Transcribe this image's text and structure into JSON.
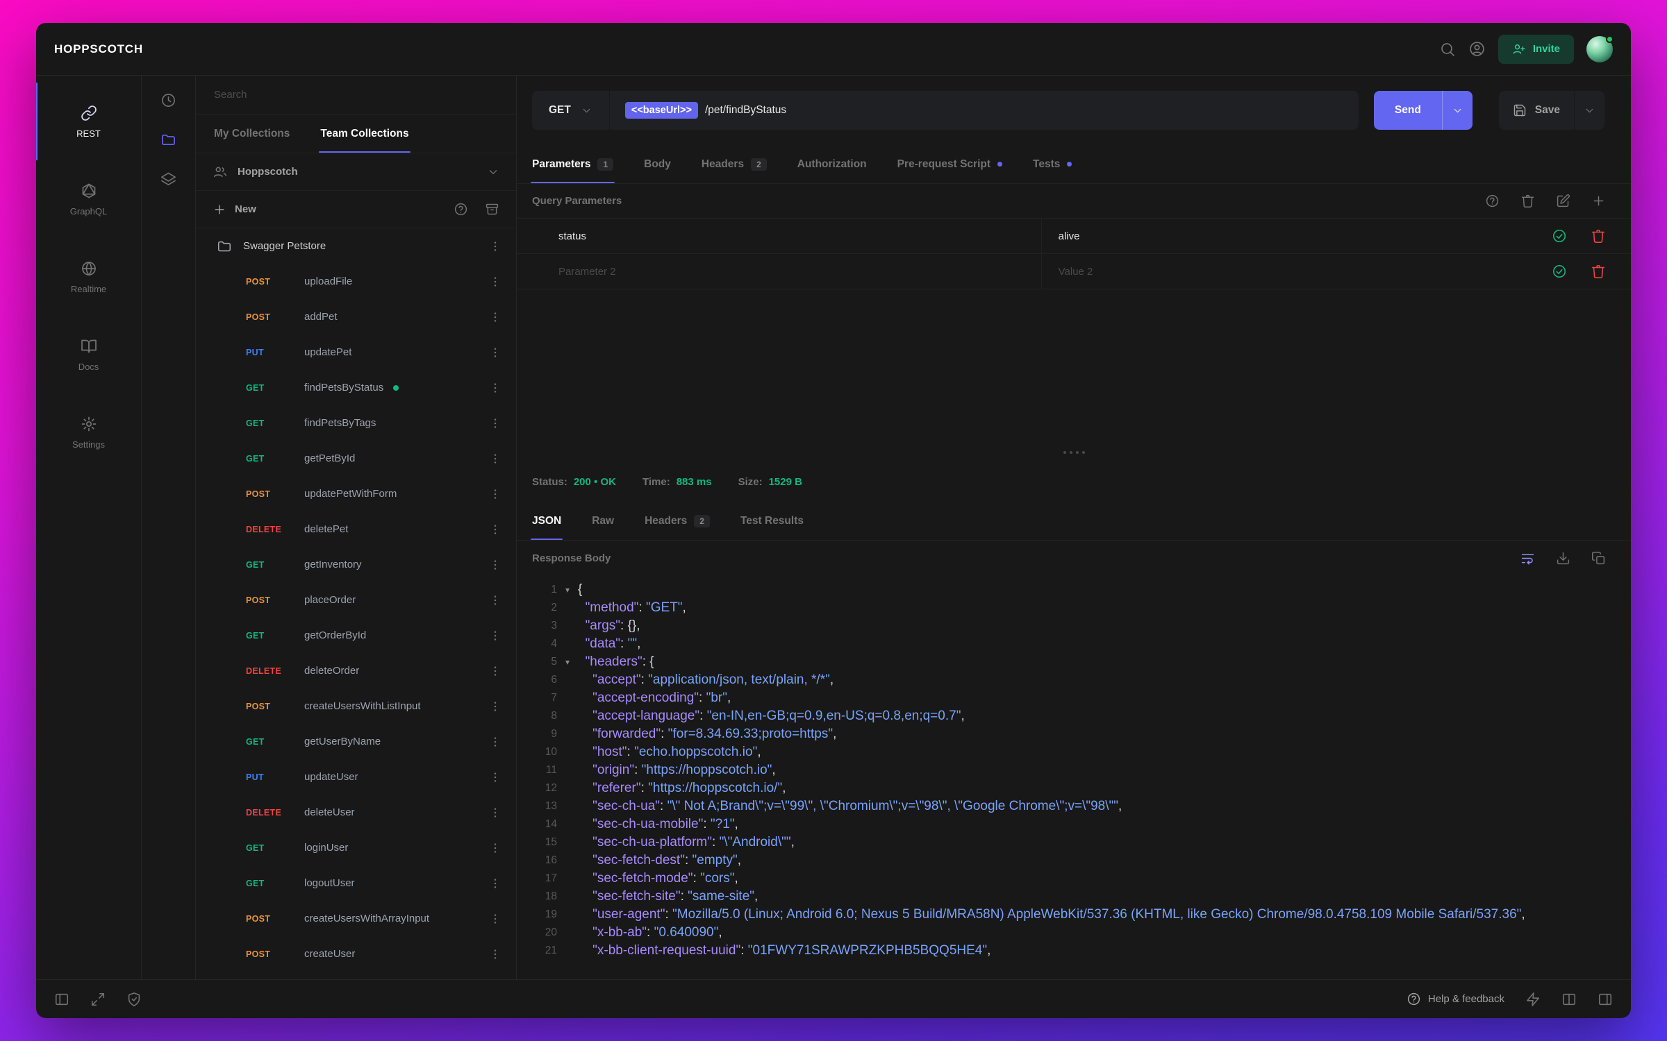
{
  "window": {
    "logo": "HOPPSCOTCH"
  },
  "topbar": {
    "invite_label": "Invite"
  },
  "icons": {
    "topbar": [
      "search-icon",
      "account-icon",
      "invite-person-plus-icon",
      "avatar"
    ],
    "nav": [
      "link-icon",
      "graphql-icon",
      "globe-icon",
      "book-icon",
      "settings-icon"
    ],
    "strip": [
      "history-clock-icon",
      "folder-icon",
      "layers-icon"
    ],
    "actions": [
      "help-circle-icon",
      "trash-icon",
      "edit-icon",
      "plus-icon",
      "check-circle-icon",
      "wrap-text-icon",
      "download-icon",
      "copy-icon"
    ],
    "bottombar": [
      "panel-left-icon",
      "expand-icon",
      "shield-check-icon",
      "zap-icon",
      "columns-icon",
      "panel-right-icon"
    ]
  },
  "nav": {
    "items": [
      {
        "label": "REST",
        "active": true
      },
      {
        "label": "GraphQL"
      },
      {
        "label": "Realtime"
      },
      {
        "label": "Docs"
      },
      {
        "label": "Settings"
      }
    ]
  },
  "collections": {
    "search_placeholder": "Search",
    "tabs": [
      {
        "label": "My Collections"
      },
      {
        "label": "Team Collections",
        "active": true
      }
    ],
    "team_name": "Hoppscotch",
    "new_label": "New",
    "folder_name": "Swagger Petstore",
    "requests": [
      {
        "method": "POST",
        "name": "uploadFile"
      },
      {
        "method": "POST",
        "name": "addPet"
      },
      {
        "method": "PUT",
        "name": "updatePet"
      },
      {
        "method": "GET",
        "name": "findPetsByStatus",
        "dot": true
      },
      {
        "method": "GET",
        "name": "findPetsByTags"
      },
      {
        "method": "GET",
        "name": "getPetById"
      },
      {
        "method": "POST",
        "name": "updatePetWithForm"
      },
      {
        "method": "DELETE",
        "name": "deletePet"
      },
      {
        "method": "GET",
        "name": "getInventory"
      },
      {
        "method": "POST",
        "name": "placeOrder"
      },
      {
        "method": "GET",
        "name": "getOrderById"
      },
      {
        "method": "DELETE",
        "name": "deleteOrder"
      },
      {
        "method": "POST",
        "name": "createUsersWithListInput"
      },
      {
        "method": "GET",
        "name": "getUserByName"
      },
      {
        "method": "PUT",
        "name": "updateUser"
      },
      {
        "method": "DELETE",
        "name": "deleteUser"
      },
      {
        "method": "GET",
        "name": "loginUser"
      },
      {
        "method": "GET",
        "name": "logoutUser"
      },
      {
        "method": "POST",
        "name": "createUsersWithArrayInput"
      },
      {
        "method": "POST",
        "name": "createUser"
      }
    ]
  },
  "request": {
    "method": "GET",
    "url_chip": "<<baseUrl>>",
    "url_path": "/pet/findByStatus",
    "send_label": "Send",
    "save_label": "Save",
    "tabs": [
      {
        "label": "Parameters",
        "badge": "1",
        "active": true
      },
      {
        "label": "Body"
      },
      {
        "label": "Headers",
        "badge": "2"
      },
      {
        "label": "Authorization"
      },
      {
        "label": "Pre-request Script",
        "dot": true
      },
      {
        "label": "Tests",
        "dot": true
      }
    ],
    "section_title": "Query Parameters",
    "params": [
      {
        "key": "status",
        "value": "alive",
        "filled": true
      },
      {
        "key": "Parameter 2",
        "value": "Value 2"
      }
    ]
  },
  "response": {
    "meta": {
      "status_label": "Status:",
      "status_value": "200 • OK",
      "time_label": "Time:",
      "time_value": "883 ms",
      "size_label": "Size:",
      "size_value": "1529 B"
    },
    "tabs": [
      {
        "label": "JSON",
        "active": true
      },
      {
        "label": "Raw"
      },
      {
        "label": "Headers",
        "badge": "2"
      },
      {
        "label": "Test Results"
      }
    ],
    "body_title": "Response Body",
    "code": [
      {
        "n": "1",
        "fold": true,
        "tokens": [
          [
            "p",
            "{"
          ]
        ]
      },
      {
        "n": "2",
        "tokens": [
          [
            "p",
            "  "
          ],
          [
            "k",
            "\"method\""
          ],
          [
            "p",
            ": "
          ],
          [
            "s",
            "\"GET\""
          ],
          [
            "p",
            ","
          ]
        ]
      },
      {
        "n": "3",
        "tokens": [
          [
            "p",
            "  "
          ],
          [
            "k",
            "\"args\""
          ],
          [
            "p",
            ": {},"
          ]
        ]
      },
      {
        "n": "4",
        "tokens": [
          [
            "p",
            "  "
          ],
          [
            "k",
            "\"data\""
          ],
          [
            "p",
            ": "
          ],
          [
            "s",
            "\"\""
          ],
          [
            "p",
            ","
          ]
        ]
      },
      {
        "n": "5",
        "fold": true,
        "tokens": [
          [
            "p",
            "  "
          ],
          [
            "k",
            "\"headers\""
          ],
          [
            "p",
            ": {"
          ]
        ]
      },
      {
        "n": "6",
        "tokens": [
          [
            "p",
            "    "
          ],
          [
            "k",
            "\"accept\""
          ],
          [
            "p",
            ": "
          ],
          [
            "s",
            "\"application/json, text/plain, */*\""
          ],
          [
            "p",
            ","
          ]
        ]
      },
      {
        "n": "7",
        "tokens": [
          [
            "p",
            "    "
          ],
          [
            "k",
            "\"accept-encoding\""
          ],
          [
            "p",
            ": "
          ],
          [
            "s",
            "\"br\""
          ],
          [
            "p",
            ","
          ]
        ]
      },
      {
        "n": "8",
        "tokens": [
          [
            "p",
            "    "
          ],
          [
            "k",
            "\"accept-language\""
          ],
          [
            "p",
            ": "
          ],
          [
            "s",
            "\"en-IN,en-GB;q=0.9,en-US;q=0.8,en;q=0.7\""
          ],
          [
            "p",
            ","
          ]
        ]
      },
      {
        "n": "9",
        "tokens": [
          [
            "p",
            "    "
          ],
          [
            "k",
            "\"forwarded\""
          ],
          [
            "p",
            ": "
          ],
          [
            "s",
            "\"for=8.34.69.33;proto=https\""
          ],
          [
            "p",
            ","
          ]
        ]
      },
      {
        "n": "10",
        "tokens": [
          [
            "p",
            "    "
          ],
          [
            "k",
            "\"host\""
          ],
          [
            "p",
            ": "
          ],
          [
            "s",
            "\"echo.hoppscotch.io\""
          ],
          [
            "p",
            ","
          ]
        ]
      },
      {
        "n": "11",
        "tokens": [
          [
            "p",
            "    "
          ],
          [
            "k",
            "\"origin\""
          ],
          [
            "p",
            ": "
          ],
          [
            "s",
            "\"https://hoppscotch.io\""
          ],
          [
            "p",
            ","
          ]
        ]
      },
      {
        "n": "12",
        "tokens": [
          [
            "p",
            "    "
          ],
          [
            "k",
            "\"referer\""
          ],
          [
            "p",
            ": "
          ],
          [
            "s",
            "\"https://hoppscotch.io/\""
          ],
          [
            "p",
            ","
          ]
        ]
      },
      {
        "n": "13",
        "tokens": [
          [
            "p",
            "    "
          ],
          [
            "k",
            "\"sec-ch-ua\""
          ],
          [
            "p",
            ": "
          ],
          [
            "s",
            "\"\\\" Not A;Brand\\\";v=\\\"99\\\", \\\"Chromium\\\";v=\\\"98\\\", \\\"Google Chrome\\\";v=\\\"98\\\"\""
          ],
          [
            "p",
            ","
          ]
        ]
      },
      {
        "n": "14",
        "tokens": [
          [
            "p",
            "    "
          ],
          [
            "k",
            "\"sec-ch-ua-mobile\""
          ],
          [
            "p",
            ": "
          ],
          [
            "s",
            "\"?1\""
          ],
          [
            "p",
            ","
          ]
        ]
      },
      {
        "n": "15",
        "tokens": [
          [
            "p",
            "    "
          ],
          [
            "k",
            "\"sec-ch-ua-platform\""
          ],
          [
            "p",
            ": "
          ],
          [
            "s",
            "\"\\\"Android\\\"\""
          ],
          [
            "p",
            ","
          ]
        ]
      },
      {
        "n": "16",
        "tokens": [
          [
            "p",
            "    "
          ],
          [
            "k",
            "\"sec-fetch-dest\""
          ],
          [
            "p",
            ": "
          ],
          [
            "s",
            "\"empty\""
          ],
          [
            "p",
            ","
          ]
        ]
      },
      {
        "n": "17",
        "tokens": [
          [
            "p",
            "    "
          ],
          [
            "k",
            "\"sec-fetch-mode\""
          ],
          [
            "p",
            ": "
          ],
          [
            "s",
            "\"cors\""
          ],
          [
            "p",
            ","
          ]
        ]
      },
      {
        "n": "18",
        "tokens": [
          [
            "p",
            "    "
          ],
          [
            "k",
            "\"sec-fetch-site\""
          ],
          [
            "p",
            ": "
          ],
          [
            "s",
            "\"same-site\""
          ],
          [
            "p",
            ","
          ]
        ]
      },
      {
        "n": "19",
        "tokens": [
          [
            "p",
            "    "
          ],
          [
            "k",
            "\"user-agent\""
          ],
          [
            "p",
            ": "
          ],
          [
            "s",
            "\"Mozilla/5.0 (Linux; Android 6.0; Nexus 5 Build/MRA58N) AppleWebKit/537.36 (KHTML, like Gecko) Chrome/98.0.4758.109 Mobile Safari/537.36\""
          ],
          [
            "p",
            ","
          ]
        ]
      },
      {
        "n": "20",
        "tokens": [
          [
            "p",
            "    "
          ],
          [
            "k",
            "\"x-bb-ab\""
          ],
          [
            "p",
            ": "
          ],
          [
            "s",
            "\"0.640090\""
          ],
          [
            "p",
            ","
          ]
        ]
      },
      {
        "n": "21",
        "tokens": [
          [
            "p",
            "    "
          ],
          [
            "k",
            "\"x-bb-client-request-uuid\""
          ],
          [
            "p",
            ": "
          ],
          [
            "s",
            "\"01FWY71SRAWPRZKPHB5BQQ5HE4\""
          ],
          [
            "p",
            ","
          ]
        ]
      }
    ]
  },
  "statusbar": {
    "help_label": "Help & feedback"
  }
}
